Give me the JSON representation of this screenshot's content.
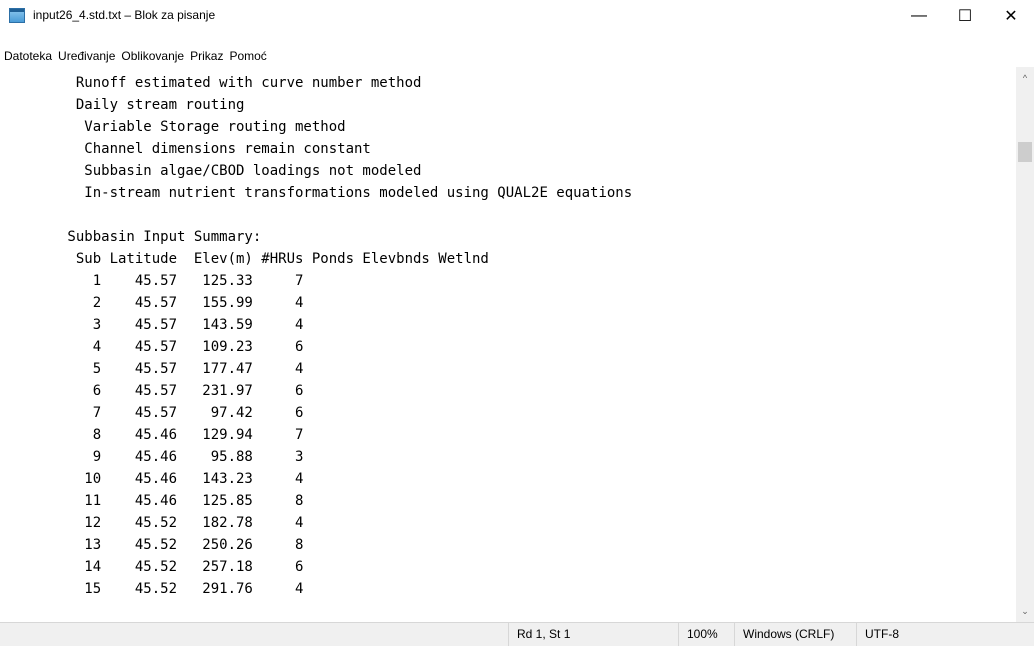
{
  "window": {
    "title": "input26_4.std.txt – Blok za pisanje",
    "minimize_glyph": "—",
    "maximize_glyph": "☐",
    "close_glyph": "✕"
  },
  "menu": [
    "Datoteka",
    "Uređivanje",
    "Oblikovanje",
    "Prikaz",
    "Pomoć"
  ],
  "editor": {
    "lines": [
      "         Runoff estimated with curve number method",
      "         Daily stream routing",
      "          Variable Storage routing method",
      "          Channel dimensions remain constant",
      "          Subbasin algae/CBOD loadings not modeled",
      "          In-stream nutrient transformations modeled using QUAL2E equations",
      "",
      "        Subbasin Input Summary:",
      "         Sub Latitude  Elev(m) #HRUs Ponds Elevbnds Wetlnd",
      "           1    45.57   125.33     7",
      "           2    45.57   155.99     4",
      "           3    45.57   143.59     4",
      "           4    45.57   109.23     6",
      "           5    45.57   177.47     4",
      "           6    45.57   231.97     6",
      "           7    45.57    97.42     6",
      "           8    45.46   129.94     7",
      "           9    45.46    95.88     3",
      "          10    45.46   143.23     4",
      "          11    45.46   125.85     8",
      "          12    45.52   182.78     4",
      "          13    45.52   250.26     8",
      "          14    45.52   257.18     6",
      "          15    45.52   291.76     4"
    ]
  },
  "scrollbar": {
    "up_glyph": "^",
    "down_glyph": "⌄"
  },
  "status": {
    "position": "Rd 1, St 1",
    "zoom": "100%",
    "line_ending": "Windows (CRLF)",
    "encoding": "UTF-8"
  }
}
